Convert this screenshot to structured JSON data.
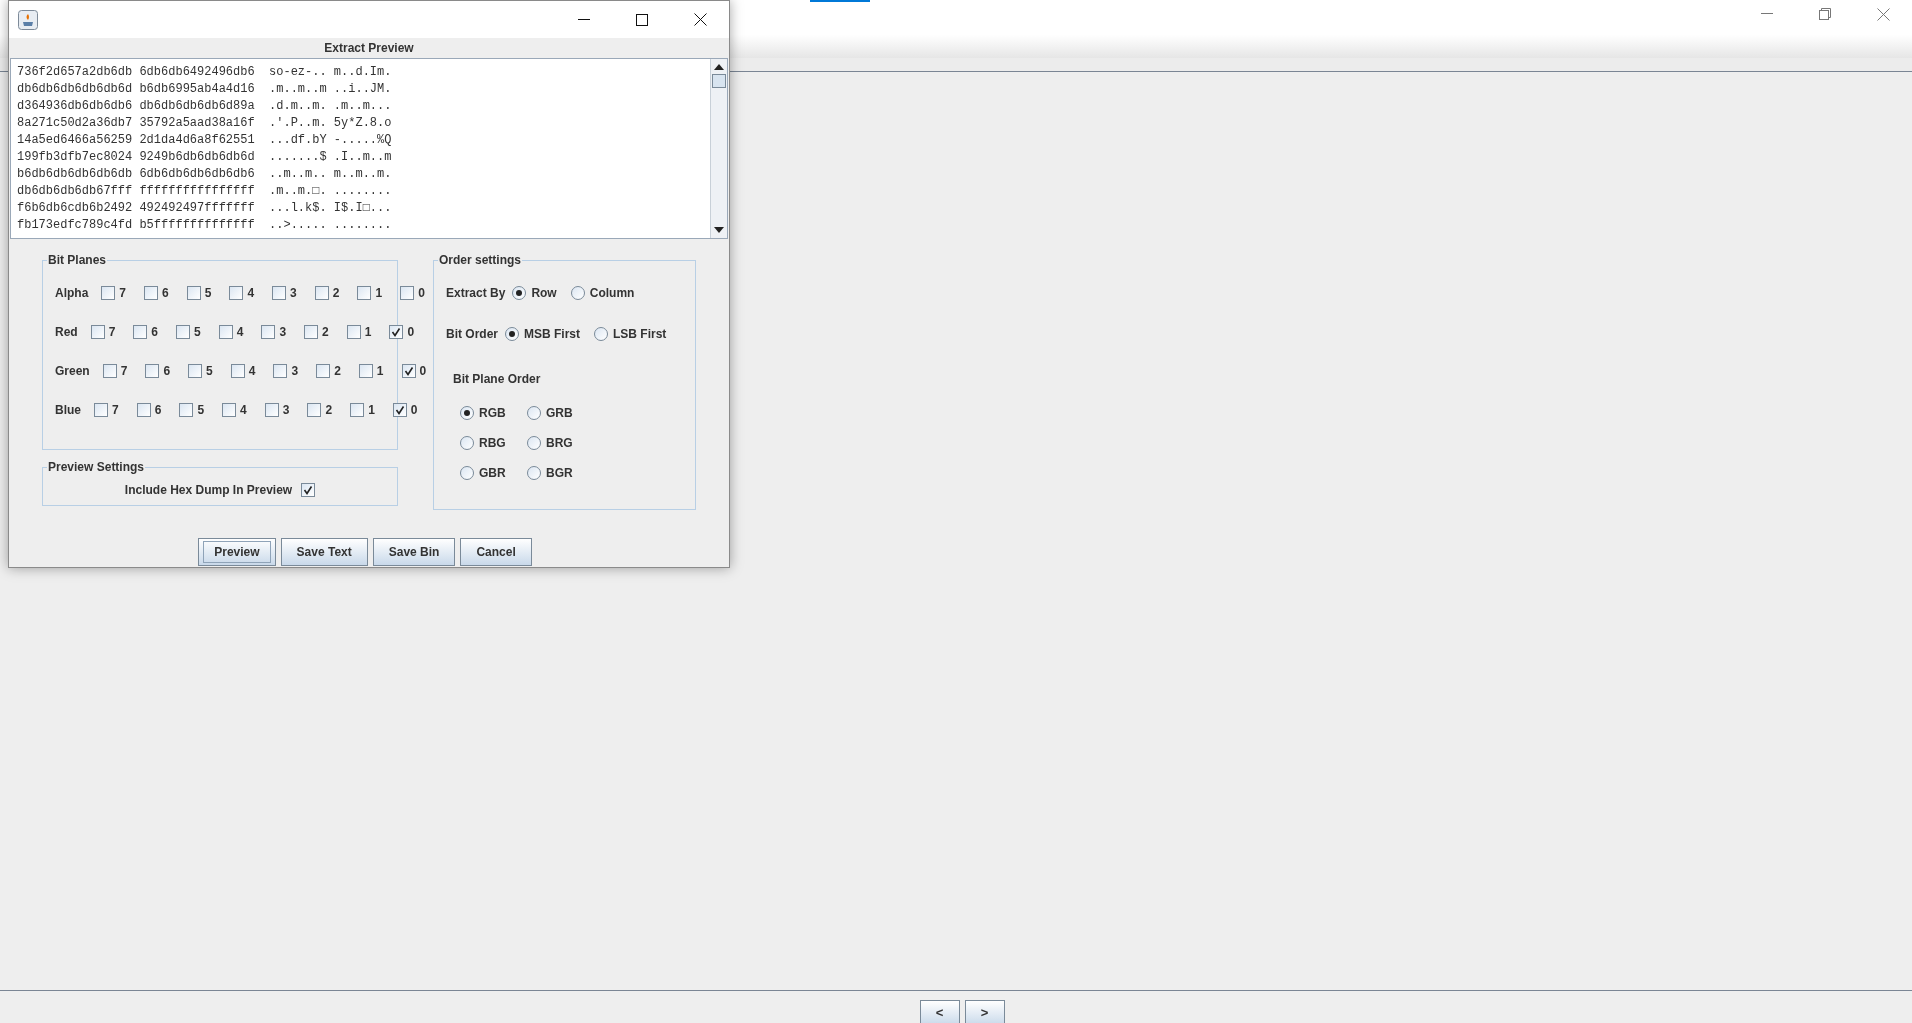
{
  "background_window": {
    "nav_buttons": [
      "<",
      ">"
    ]
  },
  "dialog": {
    "preview": {
      "title": "Extract Preview",
      "lines": [
        "736f2d657a2db6db 6db6db6492496db6  so-ez-.. m..d.Im.",
        "db6db6db6db6db6d b6db6995ab4a4d16  .m..m..m ..i..JM.",
        "d364936db6db6db6 db6db6db6db6d89a  .d.m..m. .m..m...",
        "8a271c50d2a36db7 35792a5aad38a16f  .'.P..m. 5y*Z.8.o",
        "14a5ed6466a56259 2d1da4d6a8f62551  ...df.bY -.....%Q",
        "199fb3dfb7ec8024 9249b6db6db6db6d  .......$ .I..m..m",
        "b6db6db6db6db6db 6db6db6db6db6db6  ..m..m.. m..m..m.",
        "db6db6db6db67fff ffffffffffffffff  .m..m.□. ........",
        "f6b6db6cdb6b2492 492492497fffffff  ...l.k$. I$.I□...",
        "fb173edfc789c4fd b5ffffffffffffff  ..>..... ........"
      ]
    },
    "bit_planes": {
      "title": "Bit Planes",
      "rows": [
        {
          "label": "Alpha",
          "bits": [
            {
              "label": "7",
              "checked": false
            },
            {
              "label": "6",
              "checked": false
            },
            {
              "label": "5",
              "checked": false
            },
            {
              "label": "4",
              "checked": false
            },
            {
              "label": "3",
              "checked": false
            },
            {
              "label": "2",
              "checked": false
            },
            {
              "label": "1",
              "checked": false
            },
            {
              "label": "0",
              "checked": false
            }
          ]
        },
        {
          "label": "Red",
          "bits": [
            {
              "label": "7",
              "checked": false
            },
            {
              "label": "6",
              "checked": false
            },
            {
              "label": "5",
              "checked": false
            },
            {
              "label": "4",
              "checked": false
            },
            {
              "label": "3",
              "checked": false
            },
            {
              "label": "2",
              "checked": false
            },
            {
              "label": "1",
              "checked": false
            },
            {
              "label": "0",
              "checked": true
            }
          ]
        },
        {
          "label": "Green",
          "bits": [
            {
              "label": "7",
              "checked": false
            },
            {
              "label": "6",
              "checked": false
            },
            {
              "label": "5",
              "checked": false
            },
            {
              "label": "4",
              "checked": false
            },
            {
              "label": "3",
              "checked": false
            },
            {
              "label": "2",
              "checked": false
            },
            {
              "label": "1",
              "checked": false
            },
            {
              "label": "0",
              "checked": true
            }
          ]
        },
        {
          "label": "Blue",
          "bits": [
            {
              "label": "7",
              "checked": false
            },
            {
              "label": "6",
              "checked": false
            },
            {
              "label": "5",
              "checked": false
            },
            {
              "label": "4",
              "checked": false
            },
            {
              "label": "3",
              "checked": false
            },
            {
              "label": "2",
              "checked": false
            },
            {
              "label": "1",
              "checked": false
            },
            {
              "label": "0",
              "checked": true
            }
          ]
        }
      ]
    },
    "preview_settings": {
      "title": "Preview Settings",
      "include_hex_dump": {
        "label": "Include Hex Dump In Preview",
        "checked": true
      }
    },
    "order_settings": {
      "title": "Order settings",
      "extract_by": {
        "label": "Extract By",
        "options": [
          {
            "label": "Row",
            "selected": true
          },
          {
            "label": "Column",
            "selected": false
          }
        ]
      },
      "bit_order": {
        "label": "Bit Order",
        "options": [
          {
            "label": "MSB First",
            "selected": true
          },
          {
            "label": "LSB First",
            "selected": false
          }
        ]
      },
      "bit_plane_order": {
        "label": "Bit Plane Order",
        "options": [
          {
            "label": "RGB",
            "selected": true
          },
          {
            "label": "GRB",
            "selected": false
          },
          {
            "label": "RBG",
            "selected": false
          },
          {
            "label": "BRG",
            "selected": false
          },
          {
            "label": "GBR",
            "selected": false
          },
          {
            "label": "BGR",
            "selected": false
          }
        ]
      }
    },
    "buttons": [
      {
        "label": "Preview",
        "focused": true
      },
      {
        "label": "Save Text",
        "focused": false
      },
      {
        "label": "Save Bin",
        "focused": false
      },
      {
        "label": "Cancel",
        "focused": false
      }
    ]
  }
}
